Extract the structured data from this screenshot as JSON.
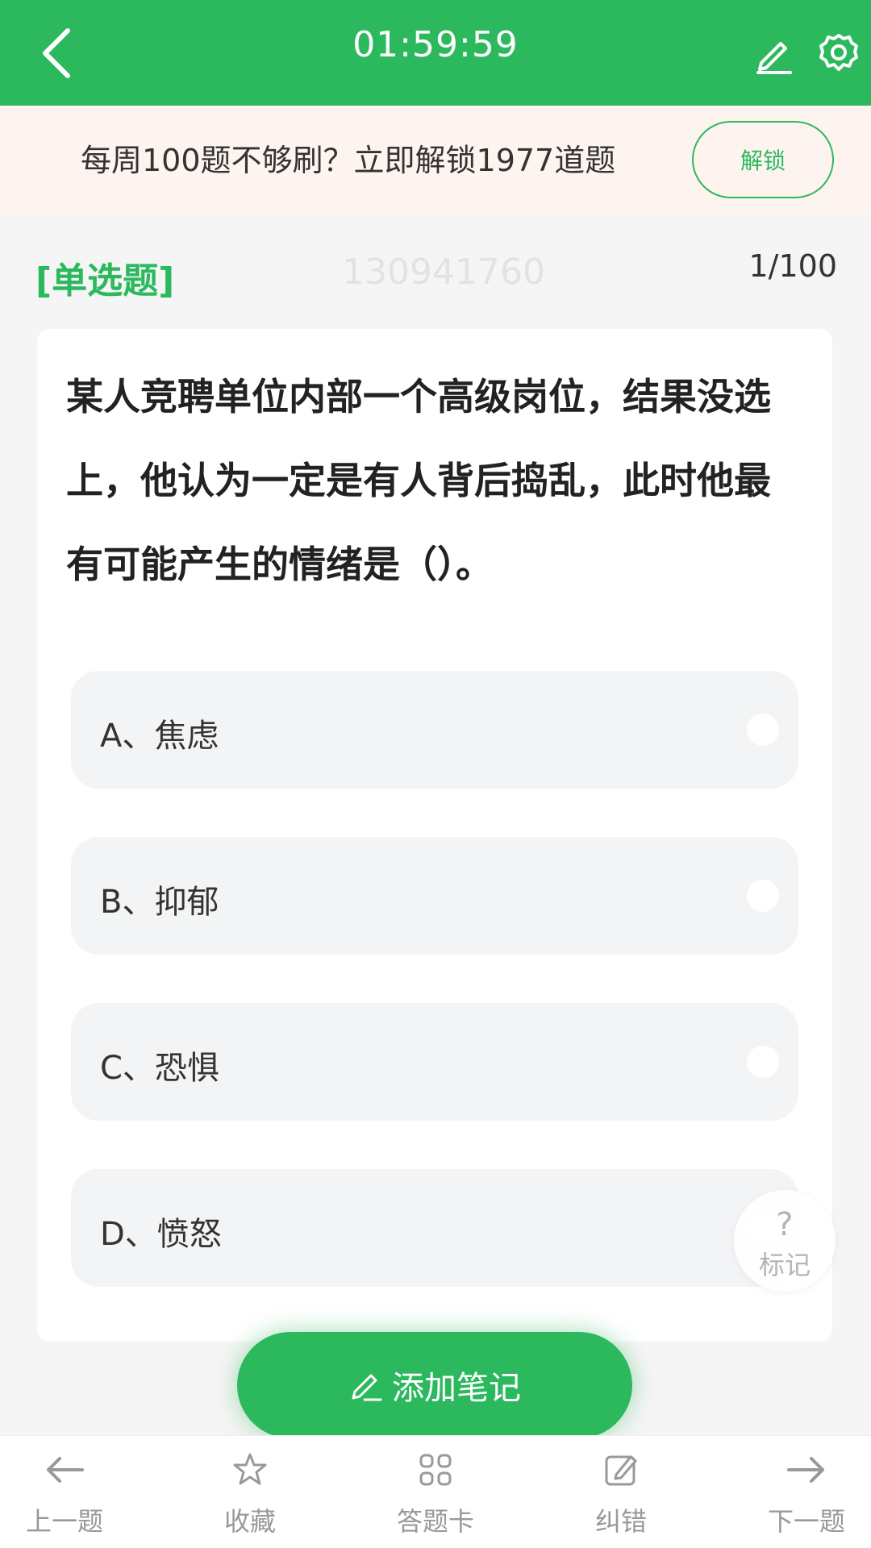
{
  "header": {
    "timer": "01:59:59",
    "icons": [
      "back-chevron-icon",
      "pencil-icon",
      "gear-icon"
    ]
  },
  "promo": {
    "text": "每周100题不够刷？立即解锁1977道题",
    "button": "解锁",
    "icon": "edit-square-icon"
  },
  "meta": {
    "type": "[单选题]",
    "watermark": "130941760",
    "progress": "1/100"
  },
  "question": {
    "text": "某人竞聘单位内部一个高级岗位，结果没选上，他认为一定是有人背后捣乱，此时他最有可能产生的情绪是（）。",
    "options": [
      "A、焦虑",
      "B、抑郁",
      "C、恐惧",
      "D、愤怒"
    ]
  },
  "mark": {
    "symbol": "?",
    "label": "标记"
  },
  "add_note": "添加笔记",
  "bottom_nav": [
    {
      "label": "上一题",
      "icon": "arrow-left-icon"
    },
    {
      "label": "收藏",
      "icon": "star-icon"
    },
    {
      "label": "答题卡",
      "icon": "grid-icon"
    },
    {
      "label": "纠错",
      "icon": "edit-square-icon"
    },
    {
      "label": "下一题",
      "icon": "arrow-right-icon"
    }
  ],
  "colors": {
    "primary": "#2cb95e",
    "promo_bg": "#fdf3ef",
    "page_bg": "#f5f5f5",
    "option_bg": "#f3f4f6"
  }
}
